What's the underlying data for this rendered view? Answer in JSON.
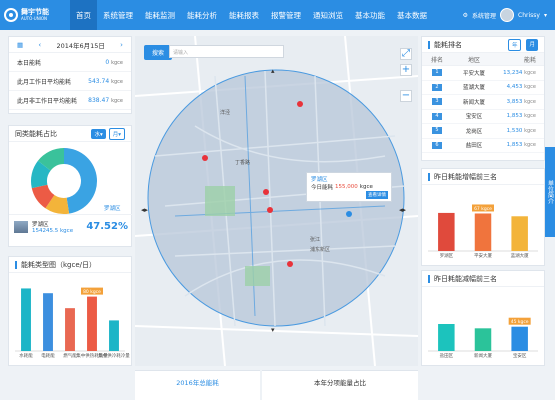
{
  "header": {
    "logo_cn": "舞宇节能",
    "logo_en": "AUTO-UNION",
    "nav": [
      "首页",
      "系统管理",
      "能耗监测",
      "能耗分析",
      "能耗报表",
      "报警管理",
      "通知浏览",
      "基本功能",
      "基本数据"
    ],
    "system_label": "系统管理",
    "user_name": "Chrissy"
  },
  "summary": {
    "date": "2014年6月15日",
    "rows": [
      {
        "label": "本日能耗",
        "value": "0",
        "unit": "kgce"
      },
      {
        "label": "此月工作日平均能耗",
        "value": "543.74",
        "unit": "kgce"
      },
      {
        "label": "此月非工作日平均能耗",
        "value": "838.47",
        "unit": "kgce"
      }
    ]
  },
  "compare": {
    "title": "同类能耗占比",
    "btn1": "水▾",
    "btn2": "月▾",
    "district_label": "罗湖区",
    "district_name": "罗湖区",
    "district_value": "154245.5 kgce",
    "percent": "47.52%",
    "slices": [
      {
        "value": 47.52,
        "color": "#3aa3e3"
      },
      {
        "value": 12,
        "color": "#f3b43a"
      },
      {
        "value": 12,
        "color": "#ec5b45"
      },
      {
        "value": 14,
        "color": "#26b7c4"
      },
      {
        "value": 14.48,
        "color": "#3ac29b"
      }
    ]
  },
  "energy_chart": {
    "title": "能耗类型图（kgce/日）",
    "chart_data": {
      "type": "bar",
      "categories": [
        "水耗能",
        "电耗能",
        "燃气能",
        "集中供热耗热量",
        "集中供冷耗冷量"
      ],
      "values": [
        92,
        85,
        63,
        80,
        45
      ],
      "highlight_label": "80 kgce",
      "highlight_index": 3,
      "colors": [
        "#1cb5c7",
        "#3c8fdf",
        "#e96852",
        "#ec5b45",
        "#1cb5c7"
      ]
    }
  },
  "map": {
    "search_btn": "搜索",
    "search_placeholder": "请输入",
    "popup": {
      "title": "罗湖区",
      "label": "今日能耗",
      "value": "155,000",
      "unit": "kgce",
      "button": "查看详情"
    },
    "place_labels": [
      "洋泾",
      "丁香路",
      "浦东新区",
      "张江"
    ]
  },
  "ranking": {
    "title": "能耗排名",
    "tab_year": "年",
    "tab_month": "月",
    "headers": [
      "排名",
      "地区",
      "能耗"
    ],
    "rows": [
      {
        "rank": "1",
        "area": "平安大厦",
        "value": "13,234",
        "unit": "kgce"
      },
      {
        "rank": "2",
        "area": "蓝湖大厦",
        "value": "4,453",
        "unit": "kgce"
      },
      {
        "rank": "3",
        "area": "新闻大厦",
        "value": "3,853",
        "unit": "kgce"
      },
      {
        "rank": "4",
        "area": "宝安区",
        "value": "1,853",
        "unit": "kgce"
      },
      {
        "rank": "5",
        "area": "龙岗区",
        "value": "1,530",
        "unit": "kgce"
      },
      {
        "rank": "6",
        "area": "盐田区",
        "value": "1,853",
        "unit": "kgce"
      }
    ]
  },
  "top_inc": {
    "title": "昨日耗能增幅前三名",
    "chart_data": {
      "type": "bar",
      "categories": [
        "罗湖区",
        "平安大厦",
        "蓝湖大厦"
      ],
      "values": [
        68,
        67,
        62
      ],
      "highlight_label": "67 kgce",
      "highlight_index": 1,
      "colors": [
        "#e04a3c",
        "#f0743d",
        "#f3b43a"
      ]
    }
  },
  "top_dec": {
    "title": "昨日耗能减幅前三名",
    "chart_data": {
      "type": "bar",
      "categories": [
        "盐田区",
        "新闻大厦",
        "宝安区"
      ],
      "values": [
        50,
        42,
        45
      ],
      "highlight_label": "45 kgce",
      "highlight_index": 2,
      "colors": [
        "#1cc3bd",
        "#2bc39a",
        "#2b8de3"
      ]
    }
  },
  "side_tab": "单位简介",
  "bottom": {
    "left": "2016年总能耗",
    "right": "本年分项能量占比"
  }
}
